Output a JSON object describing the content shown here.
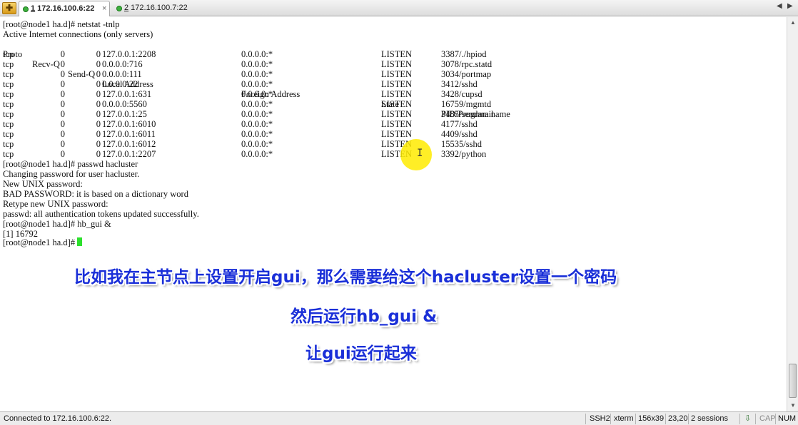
{
  "tabs": [
    {
      "num": "1",
      "label": " 172.16.100.6:22",
      "close": "×"
    },
    {
      "num": "2",
      "label": " 172.16.100.7:22"
    }
  ],
  "tabbar": {
    "add_label": "✚",
    "prev": "◀",
    "next": "▶"
  },
  "terminal": {
    "lines": [
      "[root@node1 ha.d]# netstat -tnlp",
      "Active Internet connections (only servers)"
    ],
    "netstat": {
      "headers": {
        "proto": "Proto",
        "recvq": "Recv-Q",
        "sendq": "Send-Q",
        "local": "Local Address",
        "foreign": "Foreign Address",
        "state": "State",
        "pid": "PID/Program name"
      },
      "rows": [
        {
          "proto": "tcp",
          "recvq": "0",
          "sendq": "0",
          "local": "127.0.0.1:2208",
          "foreign": "0.0.0.0:*",
          "state": "LISTEN",
          "pid": "3387/./hpiod"
        },
        {
          "proto": "tcp",
          "recvq": "0",
          "sendq": "0",
          "local": "0.0.0.0:716",
          "foreign": "0.0.0.0:*",
          "state": "LISTEN",
          "pid": "3078/rpc.statd"
        },
        {
          "proto": "tcp",
          "recvq": "0",
          "sendq": "0",
          "local": "0.0.0.0:111",
          "foreign": "0.0.0.0:*",
          "state": "LISTEN",
          "pid": "3034/portmap"
        },
        {
          "proto": "tcp",
          "recvq": "0",
          "sendq": "0",
          "local": "0.0.0.0:22",
          "foreign": "0.0.0.0:*",
          "state": "LISTEN",
          "pid": "3412/sshd"
        },
        {
          "proto": "tcp",
          "recvq": "0",
          "sendq": "0",
          "local": "127.0.0.1:631",
          "foreign": "0.0.0.0:*",
          "state": "LISTEN",
          "pid": "3428/cupsd"
        },
        {
          "proto": "tcp",
          "recvq": "0",
          "sendq": "0",
          "local": "0.0.0.0:5560",
          "foreign": "0.0.0.0:*",
          "state": "LISTEN",
          "pid": "16759/mgmtd"
        },
        {
          "proto": "tcp",
          "recvq": "0",
          "sendq": "0",
          "local": "127.0.0.1:25",
          "foreign": "0.0.0.0:*",
          "state": "LISTEN",
          "pid": "3485/sendmail"
        },
        {
          "proto": "tcp",
          "recvq": "0",
          "sendq": "0",
          "local": "127.0.0.1:6010",
          "foreign": "0.0.0.0:*",
          "state": "LISTEN",
          "pid": "4177/sshd"
        },
        {
          "proto": "tcp",
          "recvq": "0",
          "sendq": "0",
          "local": "127.0.0.1:6011",
          "foreign": "0.0.0.0:*",
          "state": "LISTEN",
          "pid": "4409/sshd"
        },
        {
          "proto": "tcp",
          "recvq": "0",
          "sendq": "0",
          "local": "127.0.0.1:6012",
          "foreign": "0.0.0.0:*",
          "state": "LISTEN",
          "pid": "15535/sshd"
        },
        {
          "proto": "tcp",
          "recvq": "0",
          "sendq": "0",
          "local": "127.0.0.1:2207",
          "foreign": "0.0.0.0:*",
          "state": "LISTEN",
          "pid": "3392/python"
        }
      ]
    },
    "after_lines": [
      "[root@node1 ha.d]# passwd hacluster",
      "Changing password for user hacluster.",
      "New UNIX password:",
      "BAD PASSWORD: it is based on a dictionary word",
      "Retype new UNIX password:",
      "passwd: all authentication tokens updated successfully.",
      "[root@node1 ha.d]# hb_gui &",
      "[1] 16792"
    ],
    "prompt": "[root@node1 ha.d]# ",
    "cursor_color": "#2de02d",
    "mouse_cursor": "I"
  },
  "subtitles": [
    "比如我在主节点上设置开启gui，那么需要给这个hacluster设置一个密码",
    "然后运行hb_gui &",
    "让gui运行起来"
  ],
  "scrollbar": {
    "up": "▲",
    "down": "▼"
  },
  "statusbar": {
    "connection": "Connected to 172.16.100.6:22.",
    "protocol": "SSH2",
    "terminal_type": "xterm",
    "size": "156x39",
    "cursor_pos": "23,20",
    "sessions": "2 sessions",
    "transfer_icon": "⇩",
    "cap": "CAP",
    "num": "NUM"
  },
  "colors": {
    "subtitle": "#1a2fd8",
    "highlight": "#ffeb00"
  }
}
